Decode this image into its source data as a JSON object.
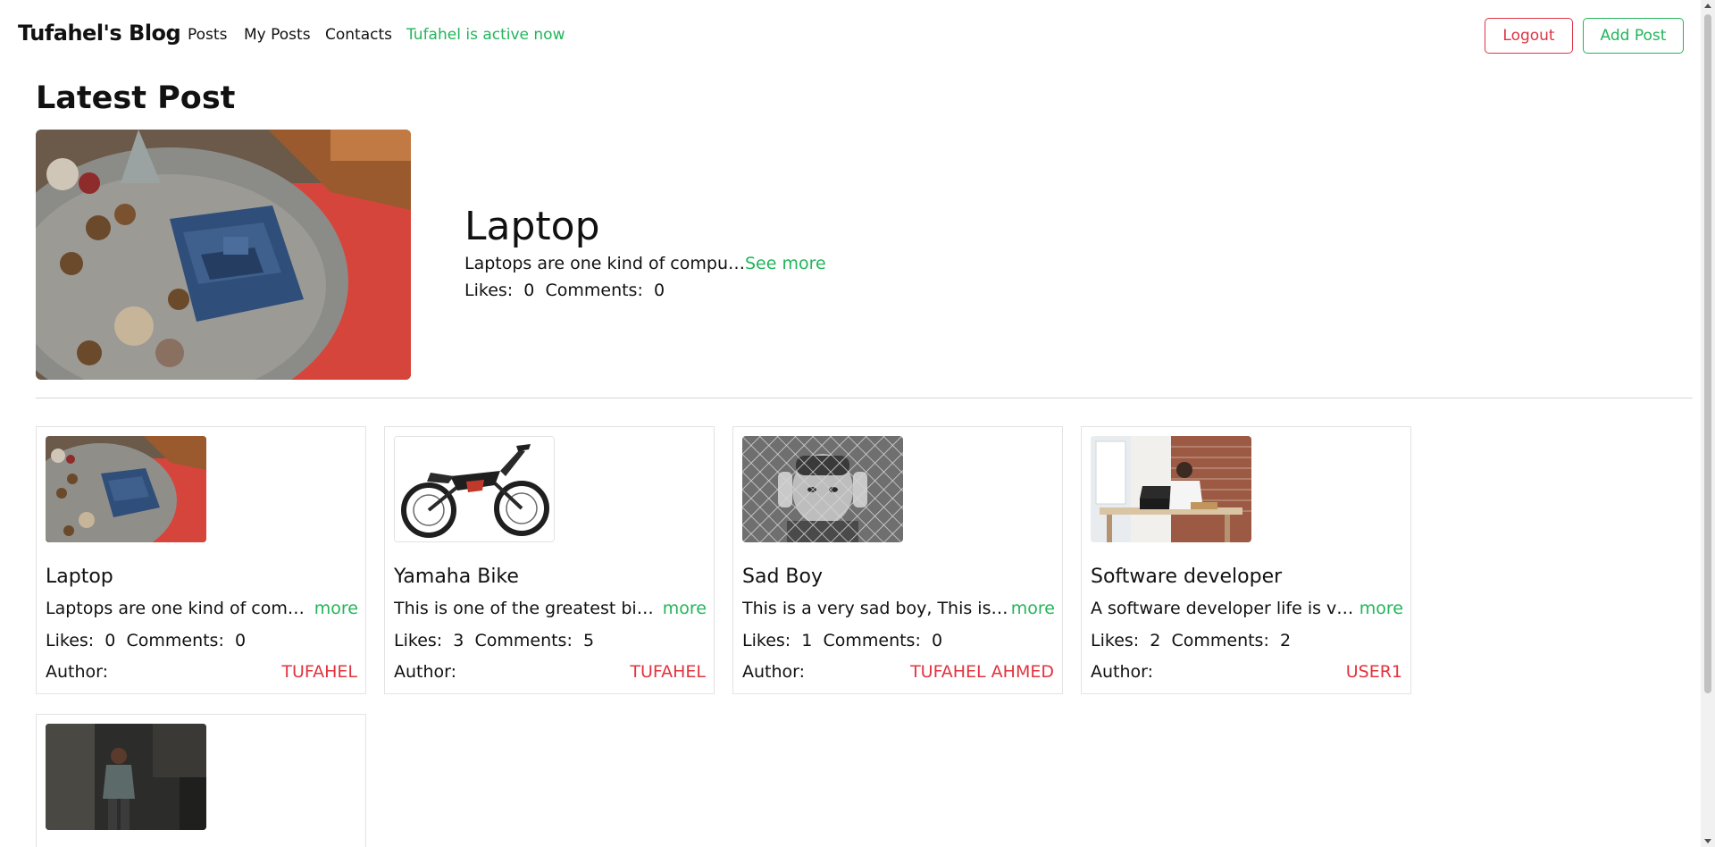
{
  "navbar": {
    "brand": "Tufahel's Blog",
    "links": [
      "Posts",
      "My Posts",
      "Contacts"
    ],
    "status": "Tufahel is active now",
    "logout_label": "Logout",
    "add_post_label": "Add Post"
  },
  "latest": {
    "heading": "Latest Post",
    "title": "Laptop",
    "excerpt": "Laptops are one kind of compu…",
    "see_more": "See more",
    "likes_label": "Likes:",
    "likes": "0",
    "comments_label": "Comments:",
    "comments": "0"
  },
  "posts": [
    {
      "title": "Laptop",
      "excerpt": "Laptops are one kind of compu…",
      "more": "more",
      "likes_label": "Likes:",
      "likes": "0",
      "comments_label": "Comments:",
      "comments": "0",
      "author_label": "Author:",
      "author": "TUFAHEL"
    },
    {
      "title": "Yamaha Bike",
      "excerpt": "This is one of the greatest bike…",
      "more": "more",
      "likes_label": "Likes:",
      "likes": "3",
      "comments_label": "Comments:",
      "comments": "5",
      "author_label": "Author:",
      "author": "TUFAHEL"
    },
    {
      "title": "Sad Boy",
      "excerpt": "This is a very sad boy, This is a …",
      "more": "more",
      "likes_label": "Likes:",
      "likes": "1",
      "comments_label": "Comments:",
      "comments": "0",
      "author_label": "Author:",
      "author": "TUFAHEL AHMED"
    },
    {
      "title": "Software developer",
      "excerpt": "A software developer life is ve…",
      "more": "more",
      "likes_label": "Likes:",
      "likes": "2",
      "comments_label": "Comments:",
      "comments": "2",
      "author_label": "Author:",
      "author": "USER1"
    }
  ],
  "colors": {
    "accent_green": "#22b55a",
    "danger_red": "#dc3545",
    "author_red": "#e2333f"
  },
  "icons": [
    "scroll-up-arrow-icon",
    "scroll-down-arrow-icon"
  ]
}
